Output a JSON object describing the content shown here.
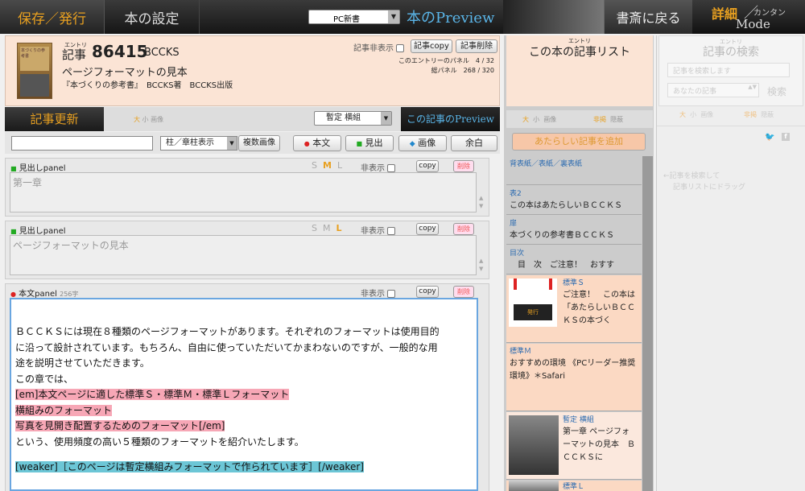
{
  "topbar": {
    "save": "保存／発行",
    "settings": "本の設定",
    "format_value": "PC新書",
    "preview": "本のPreview",
    "return": "書斎に戻る",
    "detail": "詳細",
    "slash": "／",
    "simple": "カンタン",
    "mode": "Mode"
  },
  "entry": {
    "kana": "エントリ",
    "label": "記事",
    "number": "86415",
    "book_code": "BCCKS",
    "title": "ページフォーマットの見本",
    "subtitle": "『本づくりの参考書』　BCCKS著　BCCKS出版",
    "hide_label": "記事非表示",
    "copy": "記事copy",
    "delete": "記事削除",
    "panel_line": "このエントリーのパネル　4 / 32",
    "total_line": "総パネル　268 / 320",
    "thumb_text": "本づくりの参考書"
  },
  "tools": {
    "update": "記事更新",
    "size_large": "大",
    "size_small": "小",
    "image": "画像",
    "template": "暫定 横組",
    "entry_preview": "この記事のPreview"
  },
  "insert": {
    "pillar": "柱／章柱表示",
    "multi_image": "複数画像",
    "body": "本文",
    "heading": "見出",
    "image": "画像",
    "space": "余白"
  },
  "panels": [
    {
      "title": "見出しpanel",
      "s": "S",
      "m": "M",
      "l": "L",
      "hide": "非表示",
      "copy": "copy",
      "delete": "削除",
      "text": "第一章"
    },
    {
      "title": "見出しpanel",
      "s": "S",
      "m": "M",
      "l": "L",
      "hide": "非表示",
      "copy": "copy",
      "delete": "削除",
      "text": "ページフォーマットの見本"
    }
  ],
  "body_panel": {
    "title": "本文panel",
    "count": "256字",
    "hide": "非表示",
    "copy": "copy",
    "delete": "削除",
    "lines": [
      "ＢＣＣＫＳには現在８種類のページフォーマットがあります。それぞれのフォーマットは使用目的",
      "に沿って設計されています。もちろん、自由に使っていただいてかまわないのですが、一般的な用",
      "途を説明させていただきます。",
      "この章では、"
    ],
    "pink1": "[em]本文ページに適した標準Ｓ・標準Ｍ・標準Ｌフォーマット",
    "pink2": "横組みのフォーマット",
    "pink3": "写真を見開き配置するためのフォーマット[/em]",
    "after": "という、使用頻度の高い５種類のフォーマットを紹介いたします。",
    "blue": "[weaker]［このページは暫定横組みフォーマットで作られています］[/weaker]"
  },
  "list": {
    "kana": "エントリ",
    "title": "この本の記事リスト",
    "size_large": "大",
    "size_small": "小",
    "image": "画像",
    "invisible": "非掲",
    "hidden": "隠蔽",
    "add": "あたらしい記事を追加",
    "items": [
      {
        "label": "背表紙／表紙／裏表紙",
        "text": ""
      },
      {
        "label": "表2",
        "text": "この本はあたらしいＢＣＣＫＳ"
      },
      {
        "label": "扉",
        "text": "本づくりの参考書ＢＣＣＫＳ"
      },
      {
        "label": "目次",
        "text": "　目　次　ご注意！　おすす"
      },
      {
        "label": "標準Ｓ",
        "text": "ご注意！　この本は「あたらしいＢＣＣＫＳの本づく",
        "thumb": "発行"
      },
      {
        "label": "標準Ｍ",
        "text": "おすすめの環境 《PCリーダー推奨環境》＊Safari"
      },
      {
        "label": "暫定 横組",
        "text": "第一章 ページフォーマットの見本　ＢＣＣＫＳに"
      },
      {
        "label": "標準Ｌ",
        "text": ""
      }
    ]
  },
  "search": {
    "kana": "エントリ",
    "title": "記事の検索",
    "placeholder": "記事を検索します",
    "scope": "あなたの記事",
    "button": "検索",
    "size_large": "大",
    "size_small": "小",
    "image": "画像",
    "invisible": "非掲",
    "hidden": "隠蔽",
    "hint1": "←記事を検索して",
    "hint2": "記事リストにドラッグ"
  },
  "colors": {
    "accent": "#e8a020",
    "preview": "#5ab5e8",
    "entry_bg": "#fbe4d5",
    "pink": "#f7a7b6",
    "blue": "#6cc6d6"
  }
}
